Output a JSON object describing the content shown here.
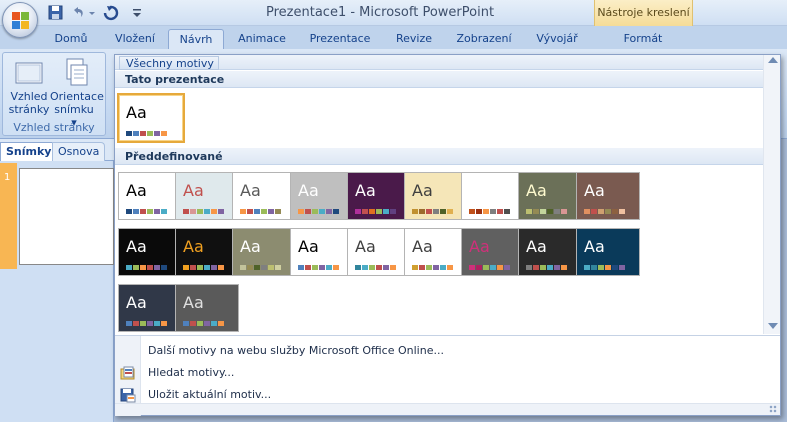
{
  "window": {
    "title": "Prezentace1 - Microsoft PowerPoint",
    "contextual_group": "Nástroje kreslení"
  },
  "tabs": [
    {
      "label": "Domů"
    },
    {
      "label": "Vložení"
    },
    {
      "label": "Návrh",
      "active": true
    },
    {
      "label": "Animace"
    },
    {
      "label": "Prezentace"
    },
    {
      "label": "Revize"
    },
    {
      "label": "Zobrazení"
    },
    {
      "label": "Vývojář"
    },
    {
      "label": "Formát",
      "contextual": true
    }
  ],
  "ribbon": {
    "page_setup_line1": "Vzhled",
    "page_setup_line2": "stránky",
    "orientation_line1": "Orientace",
    "orientation_line2": "snímku ▾",
    "group_label": "Vzhled stránky"
  },
  "slide_pane": {
    "tab_slides": "Snímky",
    "tab_outline": "Osnova",
    "slide_number": "1"
  },
  "gallery": {
    "all_themes_label": "Všechny motivy ▾",
    "section_this": "Tato prezentace",
    "section_builtin": "Předdefinované",
    "aa_text": "Aa",
    "current_theme": {
      "bg": "#ffffff",
      "fg": "#000000",
      "swatches": [
        "#1f497d",
        "#4f81bd",
        "#c0504d",
        "#9bbb59",
        "#8064a2",
        "#f79646"
      ]
    },
    "themes": [
      {
        "bg": "#ffffff",
        "fg": "#000000",
        "swatches": [
          "#1f497d",
          "#4f81bd",
          "#c0504d",
          "#9bbb59",
          "#8064a2",
          "#4bacc6"
        ]
      },
      {
        "bg": "#dfe9ec",
        "fg": "#c0504d",
        "swatches": [
          "#c0504d",
          "#d99694",
          "#9bbb59",
          "#4bacc6",
          "#f79646",
          "#8064a2"
        ]
      },
      {
        "bg": "#ffffff",
        "fg": "#595959",
        "swatches": [
          "#f79646",
          "#c0504d",
          "#4f81bd",
          "#9bbb59",
          "#8064a2",
          "#948a54"
        ]
      },
      {
        "bg": "#bfbfbf",
        "fg": "#ffffff",
        "swatches": [
          "#f79646",
          "#c0504d",
          "#9bbb59",
          "#4bacc6",
          "#8064a2",
          "#1f497d"
        ]
      },
      {
        "bg": "#4a1a4a",
        "fg": "#ffffff",
        "swatches": [
          "#b0309b",
          "#c05050",
          "#e07020",
          "#9bbb59",
          "#4bacc6",
          "#604080"
        ]
      },
      {
        "bg": "#f5e6b8",
        "fg": "#3f3f3f",
        "swatches": [
          "#c09030",
          "#9c6a2c",
          "#c0504d",
          "#7f7f7f",
          "#4f6228",
          "#e0b050"
        ]
      },
      {
        "bg": "#ffffff",
        "fg": "#ffffff",
        "swatches": [
          "#c0501a",
          "#9c3010",
          "#f79646",
          "#7f7f7f",
          "#c0504d",
          "#4f4f4f"
        ]
      },
      {
        "bg": "#6b7058",
        "fg": "#fffbd0",
        "swatches": [
          "#bcbf70",
          "#948a54",
          "#c3d69b",
          "#4f6228",
          "#7f7f7f",
          "#d99694"
        ]
      },
      {
        "bg": "#7a5a50",
        "fg": "#ffffff",
        "swatches": [
          "#e09060",
          "#c0504d",
          "#d0a070",
          "#948a54",
          "#8c6040",
          "#f0c0a0"
        ]
      },
      {
        "bg": "#0a0a0a",
        "fg": "#ffffff",
        "swatches": [
          "#4bacc6",
          "#9bbb59",
          "#f79646",
          "#c0504d",
          "#8064a2",
          "#1f497d"
        ]
      },
      {
        "bg": "#101010",
        "fg": "#f0a020",
        "swatches": [
          "#f0a020",
          "#c0504d",
          "#9bbb59",
          "#4bacc6",
          "#8064a2",
          "#f79646"
        ]
      },
      {
        "bg": "#8c8c70",
        "fg": "#ffffff",
        "swatches": [
          "#c3c39b",
          "#948a54",
          "#4f6228",
          "#7f7f7f",
          "#bcbf70",
          "#d0d0a0"
        ]
      },
      {
        "bg": "#ffffff",
        "fg": "#000000",
        "swatches": [
          "#4f81bd",
          "#c0504d",
          "#9bbb59",
          "#8064a2",
          "#4bacc6",
          "#f79646"
        ]
      },
      {
        "bg": "#ffffff",
        "fg": "#404040",
        "swatches": [
          "#31859c",
          "#4bacc6",
          "#9bbb59",
          "#c0504d",
          "#8064a2",
          "#f79646"
        ]
      },
      {
        "bg": "#ffffff",
        "fg": "#3f3f3f",
        "swatches": [
          "#d0a030",
          "#c0504d",
          "#9bbb59",
          "#8064a2",
          "#4bacc6",
          "#f79646"
        ]
      },
      {
        "bg": "#606060",
        "fg": "#d0307a",
        "swatches": [
          "#d0307a",
          "#b02060",
          "#9bbb59",
          "#4bacc6",
          "#f79646",
          "#8064a2"
        ]
      },
      {
        "bg": "#2a2a2a",
        "fg": "#ffffff",
        "swatches": [
          "#7f7f7f",
          "#c0504d",
          "#9bbb59",
          "#4bacc6",
          "#8064a2",
          "#f79646"
        ]
      },
      {
        "bg": "#0a3a5a",
        "fg": "#ffffff",
        "swatches": [
          "#4bacc6",
          "#31859c",
          "#9bbb59",
          "#f79646",
          "#1f497d",
          "#8064a2"
        ]
      },
      {
        "bg": "#303848",
        "fg": "#ffffff",
        "swatches": [
          "#4f81bd",
          "#c0504d",
          "#9bbb59",
          "#8064a2",
          "#4bacc6",
          "#f79646"
        ]
      },
      {
        "bg": "#5a5a5a",
        "fg": "#e0e0e0",
        "swatches": [
          "#4f81bd",
          "#c0504d",
          "#9bbb59",
          "#8064a2",
          "#4bacc6",
          "#f79646"
        ]
      }
    ],
    "menu": {
      "more_online": "Další motivy na webu služby Microsoft Office Online...",
      "browse": "Hledat motivy...",
      "save_current": "Uložit aktuální motiv..."
    }
  }
}
